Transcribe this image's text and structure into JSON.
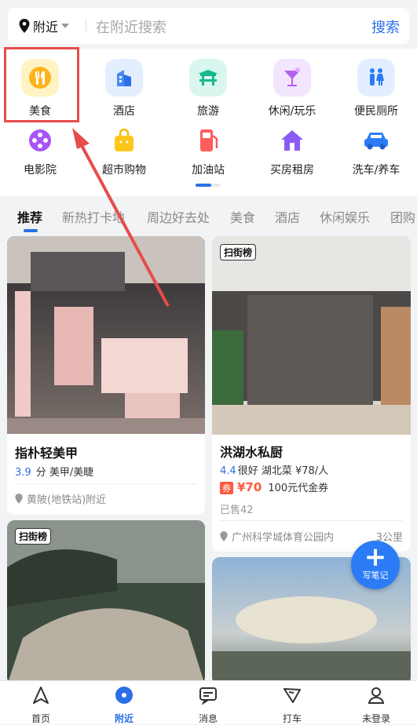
{
  "search": {
    "location_label": "附近",
    "placeholder": "在附近搜索",
    "button_label": "搜索"
  },
  "categories": [
    {
      "label": "美食",
      "icon": "fork-knife-icon"
    },
    {
      "label": "酒店",
      "icon": "hotel-building-icon"
    },
    {
      "label": "旅游",
      "icon": "pagoda-gate-icon"
    },
    {
      "label": "休闲/玩乐",
      "icon": "cocktail-icon"
    },
    {
      "label": "便民厕所",
      "icon": "restroom-icon"
    },
    {
      "label": "电影院",
      "icon": "film-reel-icon"
    },
    {
      "label": "超市购物",
      "icon": "shopping-bag-icon"
    },
    {
      "label": "加油站",
      "icon": "gas-pump-icon"
    },
    {
      "label": "买房租房",
      "icon": "house-icon"
    },
    {
      "label": "洗车/养车",
      "icon": "car-icon"
    }
  ],
  "tabs": [
    "推荐",
    "新热打卡地",
    "周边好去处",
    "美食",
    "酒店",
    "休闲娱乐",
    "团购"
  ],
  "cards": {
    "c1": {
      "title": "指朴轻美甲",
      "score": "3.9",
      "meta": "分  美甲/美睫",
      "location": "黄陂(地铁站)附近"
    },
    "c2": {
      "badge": "扫街榜",
      "title": "洪湖水私厨",
      "score": "4.4",
      "meta": "很好  湖北菜  ¥78/人",
      "coupon_tag": "券",
      "price": "¥70",
      "coupon_text": "100元代金券",
      "sold": "已售42",
      "location": "广州科学城体育公园内",
      "distance": "3公里"
    },
    "c3": {
      "badge": "扫街榜"
    }
  },
  "fab": {
    "label": "写笔记"
  },
  "bottom_nav": [
    {
      "label": "首页",
      "icon": "navigation-arrow-icon"
    },
    {
      "label": "附近",
      "icon": "nearby-dot-icon"
    },
    {
      "label": "消息",
      "icon": "message-icon"
    },
    {
      "label": "打车",
      "icon": "taxi-icon"
    },
    {
      "label": "未登录",
      "icon": "user-icon"
    }
  ],
  "colors": {
    "accent": "#2b6fe6",
    "highlight": "#e74c4c",
    "price": "#ff5a3d"
  }
}
